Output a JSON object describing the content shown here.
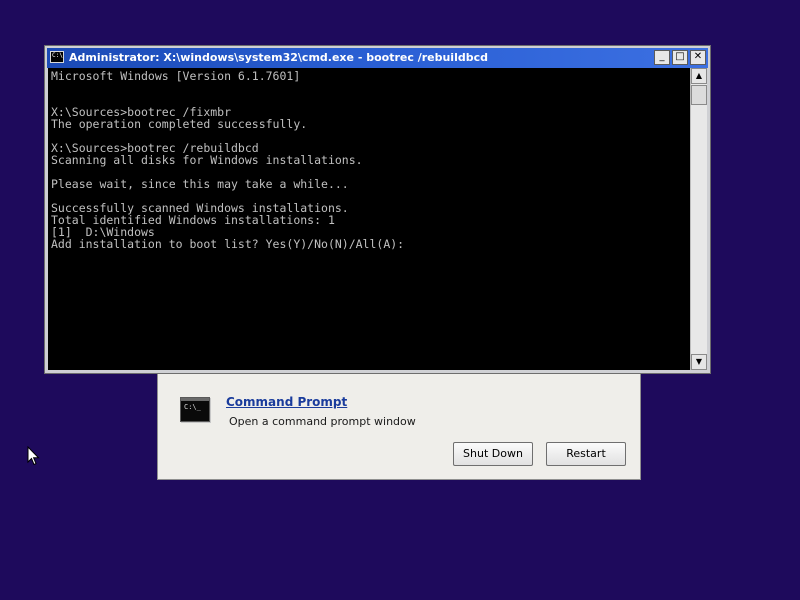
{
  "cmd_window": {
    "title": "Administrator: X:\\windows\\system32\\cmd.exe - bootrec  /rebuildbcd",
    "app_icon_glyph": "C:\\",
    "minimize_glyph": "_",
    "maximize_glyph": "□",
    "close_glyph": "✕",
    "console_lines": [
      "Microsoft Windows [Version 6.1.7601]",
      "",
      "",
      "X:\\Sources>bootrec /fixmbr",
      "The operation completed successfully.",
      "",
      "X:\\Sources>bootrec /rebuildbcd",
      "Scanning all disks for Windows installations.",
      "",
      "Please wait, since this may take a while...",
      "",
      "Successfully scanned Windows installations.",
      "Total identified Windows installations: 1",
      "[1]  D:\\Windows",
      "Add installation to boot list? Yes(Y)/No(N)/All(A):"
    ],
    "scroll_up_glyph": "▲",
    "scroll_down_glyph": "▼"
  },
  "recovery_panel": {
    "icon_glyph": "C:\\_",
    "command_prompt_link": "Command Prompt",
    "command_prompt_desc": "Open a command prompt window",
    "shutdown_label": "Shut Down",
    "restart_label": "Restart"
  },
  "colors": {
    "desktop_background": "#1e0a5c",
    "titlebar_accent": "#2a5fd4",
    "console_text": "#c0c0c0"
  }
}
